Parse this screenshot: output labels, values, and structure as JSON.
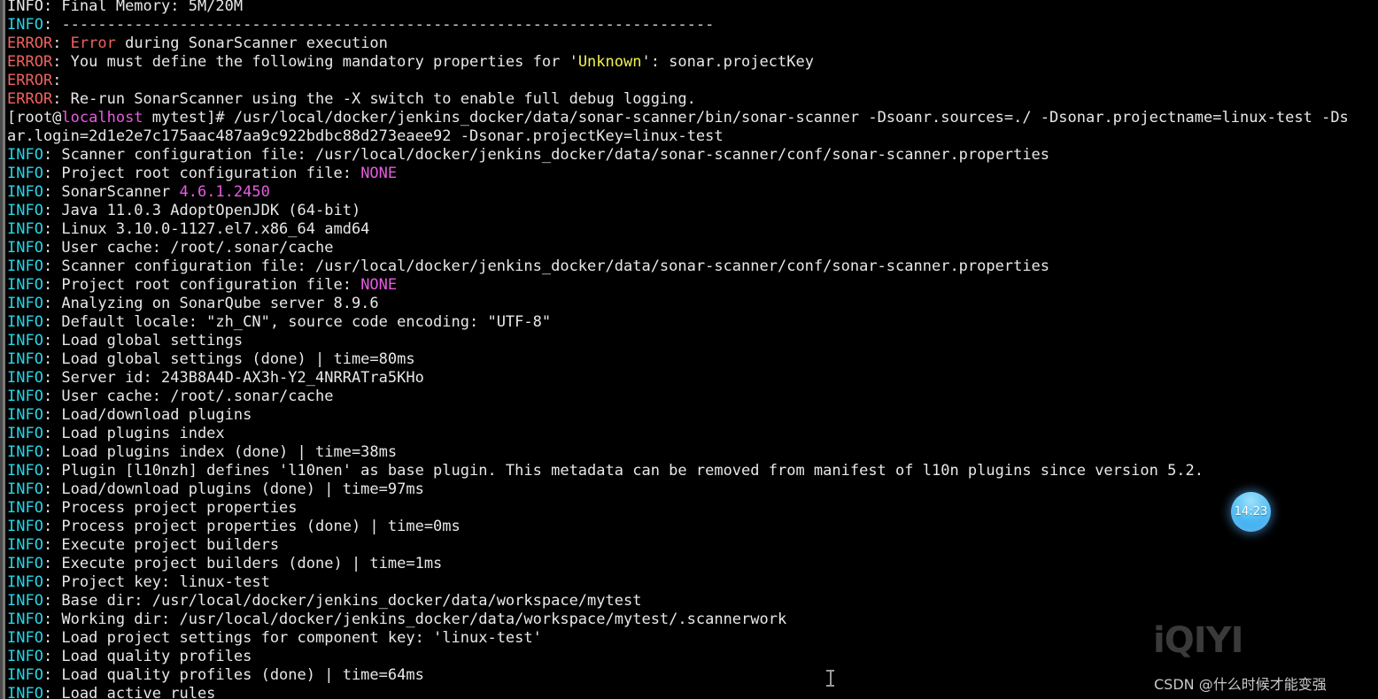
{
  "terminal": {
    "background": "#000000",
    "foreground": "#e6e6e6",
    "colors": {
      "info": "#25d7e8",
      "error": "#f2615f",
      "magenta": "#e55ce0",
      "yellow": "#f2f24f",
      "white": "#e8e8e8"
    },
    "prompt": {
      "user": "root",
      "host": "localhost",
      "cwd": "mytest",
      "symbol": "#"
    },
    "lines": [
      {
        "id": "line-final-memory",
        "segments": [
          {
            "cls": "c-white",
            "text": "INFO"
          },
          {
            "cls": "c-white",
            "text": ": Final Memory: 5M/20M"
          }
        ]
      },
      {
        "id": "line-separator",
        "segments": [
          {
            "cls": "c-info",
            "text": "INFO"
          },
          {
            "cls": "c-white",
            "text": ": "
          },
          {
            "cls": "c-dash",
            "text": "------------------------------------------------------------------------"
          }
        ]
      },
      {
        "id": "line-error-execution",
        "segments": [
          {
            "cls": "c-err",
            "text": "ERROR"
          },
          {
            "cls": "c-white",
            "text": ": "
          },
          {
            "cls": "c-err",
            "text": "Error"
          },
          {
            "cls": "c-white",
            "text": " during SonarScanner execution"
          }
        ]
      },
      {
        "id": "line-error-mandatory",
        "segments": [
          {
            "cls": "c-err",
            "text": "ERROR"
          },
          {
            "cls": "c-white",
            "text": ": You must define the following mandatory properties for '"
          },
          {
            "cls": "c-yel",
            "text": "Unknown"
          },
          {
            "cls": "c-white",
            "text": "': sonar.projectKey"
          }
        ]
      },
      {
        "id": "line-error-blank",
        "segments": [
          {
            "cls": "c-err",
            "text": "ERROR"
          },
          {
            "cls": "c-white",
            "text": ":"
          }
        ]
      },
      {
        "id": "line-error-rerun",
        "segments": [
          {
            "cls": "c-err",
            "text": "ERROR"
          },
          {
            "cls": "c-white",
            "text": ": Re-run SonarScanner using the -X switch to enable full debug logging."
          }
        ]
      },
      {
        "id": "line-prompt-command",
        "segments": [
          {
            "cls": "c-white",
            "text": "[root@"
          },
          {
            "cls": "c-mag",
            "text": "localhost"
          },
          {
            "cls": "c-white",
            "text": " mytest]# /usr/local/docker/jenkins_docker/data/sonar-scanner/bin/sonar-scanner -Dsoanr.sources=./ -Dsonar.projectname=linux-test -Ds"
          }
        ]
      },
      {
        "id": "line-command-wrap",
        "segments": [
          {
            "cls": "c-white",
            "text": "ar.login=2d1e2e7c175aac487aa9c922bdbc88d273eaee92 -Dsonar.projectKey=linux-test"
          }
        ]
      },
      {
        "id": "line-scanner-conf-1",
        "segments": [
          {
            "cls": "c-info",
            "text": "INFO"
          },
          {
            "cls": "c-white",
            "text": ": Scanner configuration file: /usr/local/docker/jenkins_docker/data/sonar-scanner/conf/sonar-scanner.properties"
          }
        ]
      },
      {
        "id": "line-project-root-1",
        "segments": [
          {
            "cls": "c-info",
            "text": "INFO"
          },
          {
            "cls": "c-white",
            "text": ": Project root configuration file: "
          },
          {
            "cls": "c-mag",
            "text": "NONE"
          }
        ]
      },
      {
        "id": "line-sonarscanner-version",
        "segments": [
          {
            "cls": "c-info",
            "text": "INFO"
          },
          {
            "cls": "c-white",
            "text": ": SonarScanner "
          },
          {
            "cls": "c-mag",
            "text": "4.6.1.2450"
          }
        ]
      },
      {
        "id": "line-java-version",
        "segments": [
          {
            "cls": "c-info",
            "text": "INFO"
          },
          {
            "cls": "c-white",
            "text": ": Java 11.0.3 AdoptOpenJDK (64-bit)"
          }
        ]
      },
      {
        "id": "line-linux-kernel",
        "segments": [
          {
            "cls": "c-info",
            "text": "INFO"
          },
          {
            "cls": "c-white",
            "text": ": Linux 3.10.0-1127.el7.x86_64 amd64"
          }
        ]
      },
      {
        "id": "line-user-cache-1",
        "segments": [
          {
            "cls": "c-info",
            "text": "INFO"
          },
          {
            "cls": "c-white",
            "text": ": User cache: /root/.sonar/cache"
          }
        ]
      },
      {
        "id": "line-scanner-conf-2",
        "segments": [
          {
            "cls": "c-info",
            "text": "INFO"
          },
          {
            "cls": "c-white",
            "text": ": Scanner configuration file: /usr/local/docker/jenkins_docker/data/sonar-scanner/conf/sonar-scanner.properties"
          }
        ]
      },
      {
        "id": "line-project-root-2",
        "segments": [
          {
            "cls": "c-info",
            "text": "INFO"
          },
          {
            "cls": "c-white",
            "text": ": Project root configuration file: "
          },
          {
            "cls": "c-mag",
            "text": "NONE"
          }
        ]
      },
      {
        "id": "line-analyzing-server",
        "segments": [
          {
            "cls": "c-info",
            "text": "INFO"
          },
          {
            "cls": "c-white",
            "text": ": Analyzing on SonarQube server 8.9.6"
          }
        ]
      },
      {
        "id": "line-default-locale",
        "segments": [
          {
            "cls": "c-info",
            "text": "INFO"
          },
          {
            "cls": "c-white",
            "text": ": Default locale: \"zh_CN\", source code encoding: \"UTF-8\""
          }
        ]
      },
      {
        "id": "line-load-global-settings",
        "segments": [
          {
            "cls": "c-info",
            "text": "INFO"
          },
          {
            "cls": "c-white",
            "text": ": Load global settings"
          }
        ]
      },
      {
        "id": "line-load-global-settings-done",
        "segments": [
          {
            "cls": "c-info",
            "text": "INFO"
          },
          {
            "cls": "c-white",
            "text": ": Load global settings (done) | time=80ms"
          }
        ]
      },
      {
        "id": "line-server-id",
        "segments": [
          {
            "cls": "c-info",
            "text": "INFO"
          },
          {
            "cls": "c-white",
            "text": ": Server id: 243B8A4D-AX3h-Y2_4NRRATra5KHo"
          }
        ]
      },
      {
        "id": "line-user-cache-2",
        "segments": [
          {
            "cls": "c-info",
            "text": "INFO"
          },
          {
            "cls": "c-white",
            "text": ": User cache: /root/.sonar/cache"
          }
        ]
      },
      {
        "id": "line-load-download-plugins",
        "segments": [
          {
            "cls": "c-info",
            "text": "INFO"
          },
          {
            "cls": "c-white",
            "text": ": Load/download plugins"
          }
        ]
      },
      {
        "id": "line-load-plugins-index",
        "segments": [
          {
            "cls": "c-info",
            "text": "INFO"
          },
          {
            "cls": "c-white",
            "text": ": Load plugins index"
          }
        ]
      },
      {
        "id": "line-load-plugins-index-done",
        "segments": [
          {
            "cls": "c-info",
            "text": "INFO"
          },
          {
            "cls": "c-white",
            "text": ": Load plugins index (done) | time=38ms"
          }
        ]
      },
      {
        "id": "line-plugin-l10n",
        "segments": [
          {
            "cls": "c-info",
            "text": "INFO"
          },
          {
            "cls": "c-white",
            "text": ": Plugin [l10nzh] defines 'l10nen' as base plugin. This metadata can be removed from manifest of l10n plugins since version 5.2."
          }
        ]
      },
      {
        "id": "line-load-download-plugins-done",
        "segments": [
          {
            "cls": "c-info",
            "text": "INFO"
          },
          {
            "cls": "c-white",
            "text": ": Load/download plugins (done) | time=97ms"
          }
        ]
      },
      {
        "id": "line-process-project-properties",
        "segments": [
          {
            "cls": "c-info",
            "text": "INFO"
          },
          {
            "cls": "c-white",
            "text": ": Process project properties"
          }
        ]
      },
      {
        "id": "line-process-project-properties-done",
        "segments": [
          {
            "cls": "c-info",
            "text": "INFO"
          },
          {
            "cls": "c-white",
            "text": ": Process project properties (done) | time=0ms"
          }
        ]
      },
      {
        "id": "line-execute-project-builders",
        "segments": [
          {
            "cls": "c-info",
            "text": "INFO"
          },
          {
            "cls": "c-white",
            "text": ": Execute project builders"
          }
        ]
      },
      {
        "id": "line-execute-project-builders-done",
        "segments": [
          {
            "cls": "c-info",
            "text": "INFO"
          },
          {
            "cls": "c-white",
            "text": ": Execute project builders (done) | time=1ms"
          }
        ]
      },
      {
        "id": "line-project-key",
        "segments": [
          {
            "cls": "c-info",
            "text": "INFO"
          },
          {
            "cls": "c-white",
            "text": ": Project key: linux-test"
          }
        ]
      },
      {
        "id": "line-base-dir",
        "segments": [
          {
            "cls": "c-info",
            "text": "INFO"
          },
          {
            "cls": "c-white",
            "text": ": Base dir: /usr/local/docker/jenkins_docker/data/workspace/mytest"
          }
        ]
      },
      {
        "id": "line-working-dir",
        "segments": [
          {
            "cls": "c-info",
            "text": "INFO"
          },
          {
            "cls": "c-white",
            "text": ": Working dir: /usr/local/docker/jenkins_docker/data/workspace/mytest/.scannerwork"
          }
        ]
      },
      {
        "id": "line-load-project-settings",
        "segments": [
          {
            "cls": "c-info",
            "text": "INFO"
          },
          {
            "cls": "c-white",
            "text": ": Load project settings for component key: 'linux-test'"
          }
        ]
      },
      {
        "id": "line-load-quality-profiles",
        "segments": [
          {
            "cls": "c-info",
            "text": "INFO"
          },
          {
            "cls": "c-white",
            "text": ": Load quality profiles"
          }
        ]
      },
      {
        "id": "line-load-quality-profiles-done",
        "segments": [
          {
            "cls": "c-info",
            "text": "INFO"
          },
          {
            "cls": "c-white",
            "text": ": Load quality profiles (done) | time=64ms"
          }
        ]
      },
      {
        "id": "line-load-active-rules",
        "segments": [
          {
            "cls": "c-info",
            "text": "INFO"
          },
          {
            "cls": "c-white",
            "text": ": Load active rules"
          }
        ]
      }
    ]
  },
  "overlays": {
    "clock": {
      "time": "14:23"
    },
    "watermark": {
      "brand": "iQIYI"
    },
    "credit": {
      "text": "CSDN @什么时候才能变强"
    }
  }
}
